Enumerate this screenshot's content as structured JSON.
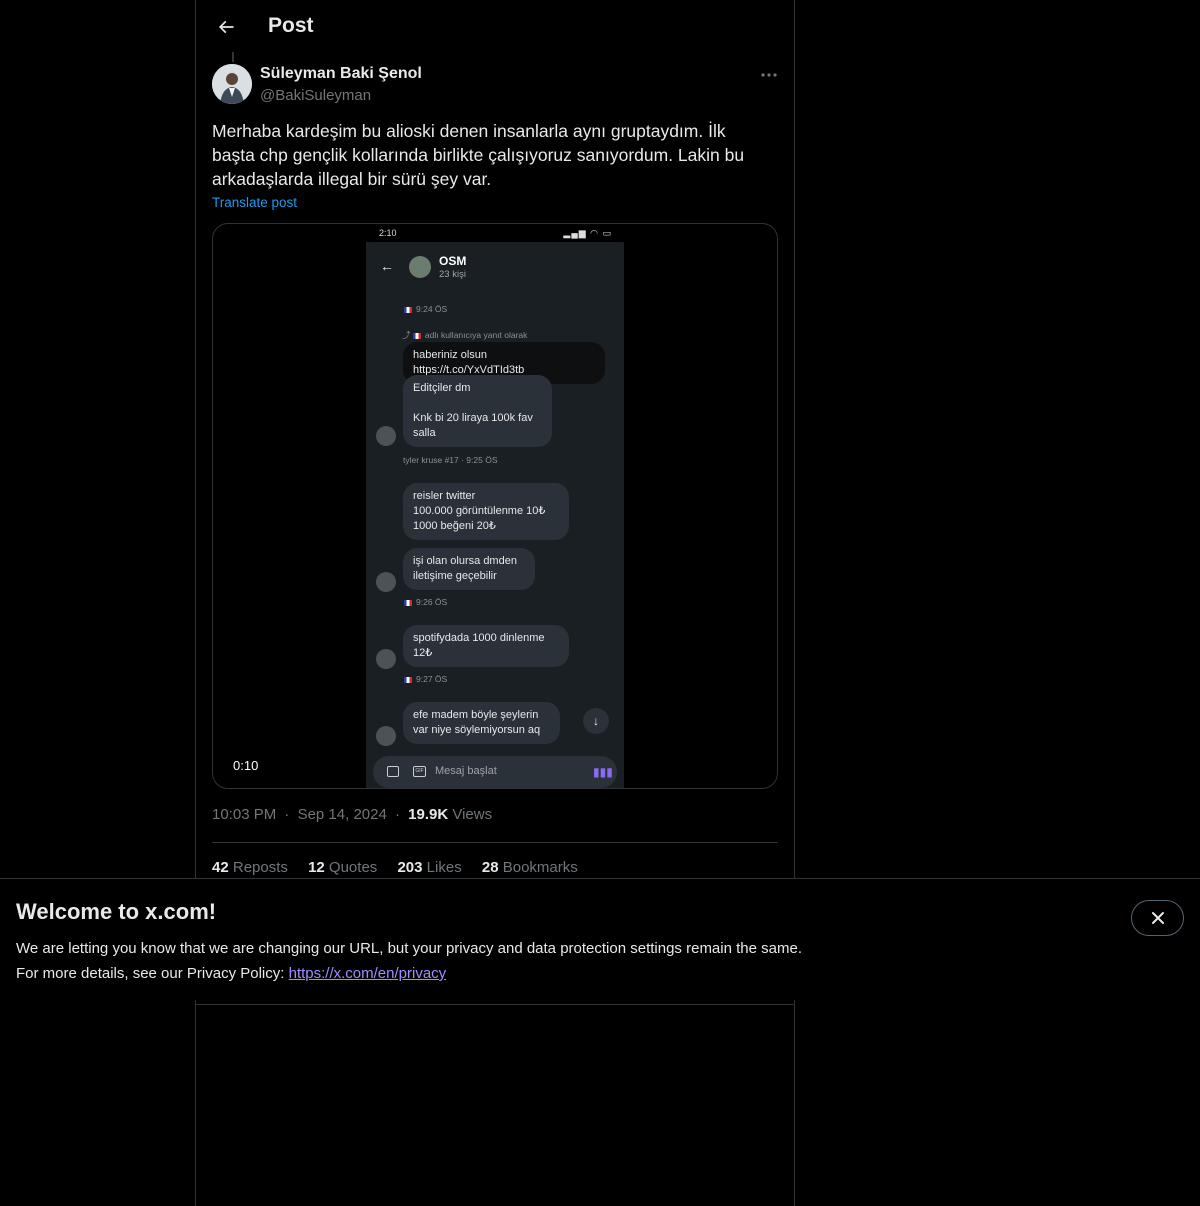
{
  "header": {
    "title": "Post",
    "back_icon": "arrow-left-icon"
  },
  "post": {
    "author_name": "Süleyman Baki Şenol",
    "author_handle": "@BakiSuleyman",
    "more_icon": "more-horizontal-icon",
    "text": "Merhaba kardeşim bu alioski denen insanlarla aynı gruptaydım. İlk başta chp gençlik kollarında birlikte çalışıyoruz sanıyordum. Lakin bu arkadaşlarda illegal bir sürü şey var.",
    "translate_label": "Translate post",
    "time": "10:03 PM",
    "date": "Sep 14, 2024",
    "views_count": "19.9K",
    "views_label": "Views",
    "separator": "·"
  },
  "video": {
    "duration": "0:10",
    "phone": {
      "status_time": "2:10",
      "group_name": "OSM",
      "group_count": "23 kişi",
      "messages": [
        {
          "meta": "9:24 ÖS"
        },
        {
          "meta": "adlı kullanıcıya yanıt olarak"
        },
        {
          "text": "haberiniz olsun https://t.co/YxVdTId3tb"
        },
        {
          "text": "Editçiler dm\n\nKnk bi 20 liraya 100k fav\nsalla"
        },
        {
          "meta": "tyler kruse #17 · 9:25 ÖS"
        },
        {
          "text": "reisler twitter\n100.000 görüntülenme 10₺\n1000 beğeni 20₺"
        },
        {
          "text": "işi olan olursa dmden\niletişime geçebilir"
        },
        {
          "meta": "9:26 ÖS"
        },
        {
          "text": "spotifydada 1000 dinlenme\n12₺"
        },
        {
          "meta": "9:27 ÖS"
        },
        {
          "text": "efe madem böyle şeylerin\nvar niye söylemiyorsun aq"
        }
      ],
      "composer_placeholder": "Mesaj başlat"
    }
  },
  "stats": [
    {
      "count": "42",
      "label": "Reposts"
    },
    {
      "count": "12",
      "label": "Quotes"
    },
    {
      "count": "203",
      "label": "Likes"
    },
    {
      "count": "28",
      "label": "Bookmarks"
    }
  ],
  "banner": {
    "title": "Welcome to x.com!",
    "line1": "We are letting you know that we are changing our URL, but your privacy and data protection settings remain the same.",
    "line2_prefix": "For more details, see our Privacy Policy:",
    "link": "https://x.com/en/privacy",
    "close_icon": "close-icon"
  },
  "colors": {
    "background": "#000000",
    "text": "#e7e9ea",
    "muted": "#71767b",
    "accent": "#1d9bf0",
    "border": "#2f3336",
    "link": "#a48bff"
  }
}
